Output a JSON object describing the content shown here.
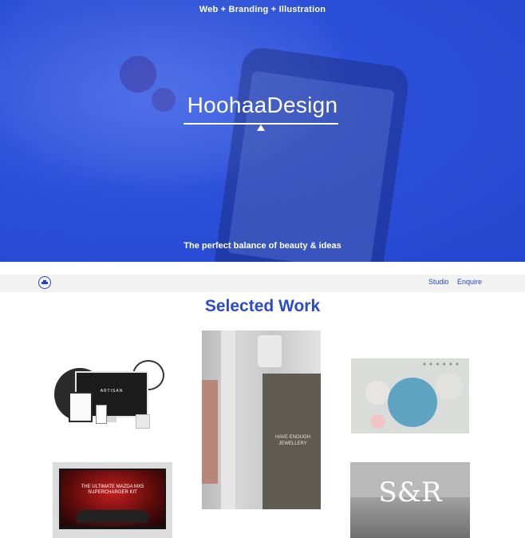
{
  "hero": {
    "tagline_top": "Web + Branding + Illustration",
    "logo": "HoohaaDesign",
    "tagline_bottom": "The perfect balance of beauty & ideas",
    "bg_color": "#2a4fd9"
  },
  "nav": {
    "brand_icon": "logo-icon",
    "links": [
      "Studio",
      "Enquire"
    ],
    "accent_color": "#2847c8"
  },
  "section": {
    "title": "Selected Work"
  },
  "work": {
    "card1": {
      "screen_text": "ARTISAN"
    },
    "card2": {
      "window_text": "HAVE ENOUGH JEWELLERY"
    },
    "card4": {
      "headline": "THE ULTIMATE MAZDA MX5 SUPERCHARGER KIT"
    },
    "card5": {
      "logo_text": "S&R"
    }
  }
}
